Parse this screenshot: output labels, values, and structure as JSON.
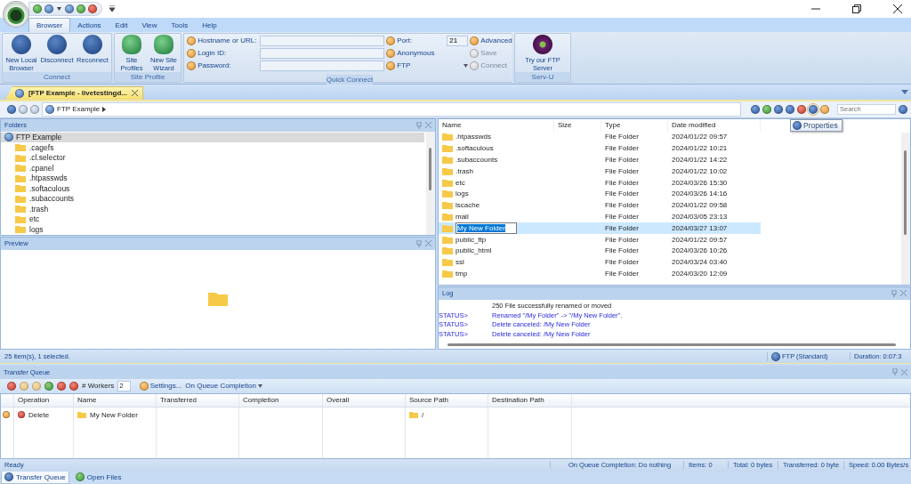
{
  "ribbon": {
    "tabs": [
      {
        "label": "Browser",
        "selected": true
      },
      {
        "label": "Actions",
        "selected": false
      },
      {
        "label": "Edit",
        "selected": false
      },
      {
        "label": "View",
        "selected": false
      },
      {
        "label": "Tools",
        "selected": false
      },
      {
        "label": "Help",
        "selected": false
      }
    ],
    "connect_group": {
      "title": "Connect",
      "buttons": [
        "New Local Browser",
        "Disconnect",
        "Reconnect"
      ]
    },
    "site_profile_group": {
      "title": "Site Profile",
      "buttons": [
        "Site Profiles",
        "New Site Wizard"
      ]
    },
    "quick_connect_group": {
      "title": "Quick Connect",
      "hostname_label": "Hostname or URL:",
      "login_label": "Login ID:",
      "password_label": "Password:",
      "port_label": "Port:",
      "port_value": "21",
      "anonymous_label": "Anonymous",
      "protocol": "FTP",
      "actions": [
        {
          "label": "Advanced",
          "disabled": false
        },
        {
          "label": "Save",
          "disabled": true
        },
        {
          "label": "Connect",
          "disabled": true
        }
      ]
    },
    "servu_group": {
      "title": "Serv-U",
      "button": "Try our FTP Server"
    }
  },
  "document_tab": "[FTP Example - livetestingd...",
  "address_bar": {
    "path": "FTP Example",
    "search_placeholder": "Search",
    "tooltip": "Properties"
  },
  "folders_panel": {
    "title": "Folders",
    "tree": [
      {
        "label": "FTP Example",
        "selected": true,
        "children": [
          {
            "label": ".cagefs"
          },
          {
            "label": ".cl.selector"
          },
          {
            "label": ".cpanel"
          },
          {
            "label": ".htpasswds"
          },
          {
            "label": ".softaculous"
          },
          {
            "label": ".subaccounts"
          },
          {
            "label": ".trash"
          },
          {
            "label": "etc"
          },
          {
            "label": "logs"
          }
        ]
      }
    ]
  },
  "preview_panel": {
    "title": "Preview"
  },
  "file_list": {
    "columns": [
      "Name",
      "Size",
      "Type",
      "Date modified"
    ],
    "rows": [
      {
        "name": ".htpasswds",
        "type": "File Folder",
        "date": "2024/01/22 09:57",
        "selected": false
      },
      {
        "name": ".softaculous",
        "type": "File Folder",
        "date": "2024/01/22 10:21",
        "selected": false
      },
      {
        "name": ".subaccounts",
        "type": "File Folder",
        "date": "2024/01/22 14:22",
        "selected": false
      },
      {
        "name": ".trash",
        "type": "File Folder",
        "date": "2024/01/22 10:02",
        "selected": false
      },
      {
        "name": "etc",
        "type": "File Folder",
        "date": "2024/03/26 15:30",
        "selected": false
      },
      {
        "name": "logs",
        "type": "File Folder",
        "date": "2024/03/26 14:16",
        "selected": false
      },
      {
        "name": "lscache",
        "type": "File Folder",
        "date": "2024/01/22 09:58",
        "selected": false
      },
      {
        "name": "mail",
        "type": "File Folder",
        "date": "2024/03/05 23:13",
        "selected": false
      },
      {
        "name": "My New Folder",
        "type": "File Folder",
        "date": "2024/03/27 13:07",
        "selected": true
      },
      {
        "name": "public_ftp",
        "type": "File Folder",
        "date": "2024/01/22 09:57",
        "selected": false
      },
      {
        "name": "public_html",
        "type": "File Folder",
        "date": "2024/03/26 10:26",
        "selected": false
      },
      {
        "name": "ssl",
        "type": "File Folder",
        "date": "2024/03/24 03:40",
        "selected": false
      },
      {
        "name": "tmp",
        "type": "File Folder",
        "date": "2024/03/20 12:09",
        "selected": false
      }
    ]
  },
  "log_panel": {
    "title": "Log",
    "lines": [
      {
        "kind": "response",
        "text": "250 File successfully renamed or moved"
      },
      {
        "kind": "status",
        "prefix": "STATUS>",
        "text": "Renamed \"/My Folder\" -> \"/My New Folder\"."
      },
      {
        "kind": "status",
        "prefix": "STATUS>",
        "text": "Delete canceled: /My New Folder"
      },
      {
        "kind": "status",
        "prefix": "STATUS>",
        "text": "Delete canceled: /My New Folder"
      }
    ]
  },
  "status_bar": {
    "items": "25 item(s), 1 selected.",
    "protocol": "FTP (Standard)",
    "duration": "Duration: 0:07:3"
  },
  "transfer_queue": {
    "title": "Transfer Queue",
    "workers_label": "# Workers",
    "workers_value": "2",
    "settings": "Settings...",
    "completion_menu": "On Queue Completion",
    "columns": [
      "Operation",
      "Name",
      "Transferred",
      "Completion",
      "Overall",
      "Source Path",
      "Destination Path"
    ],
    "rows": [
      {
        "operation": "Delete",
        "name": "My New Folder",
        "source_path": "/"
      }
    ]
  },
  "queue_status": [
    "Ready",
    "On Queue Completion: Do nothing",
    "Items: 0",
    "Total: 0 bytes",
    "Transferred: 0 byte",
    "Speed: 0.00 Bytes/s"
  ],
  "bottom_tabs": [
    {
      "label": "Transfer Queue",
      "selected": true
    },
    {
      "label": "Open Files",
      "selected": false
    }
  ]
}
